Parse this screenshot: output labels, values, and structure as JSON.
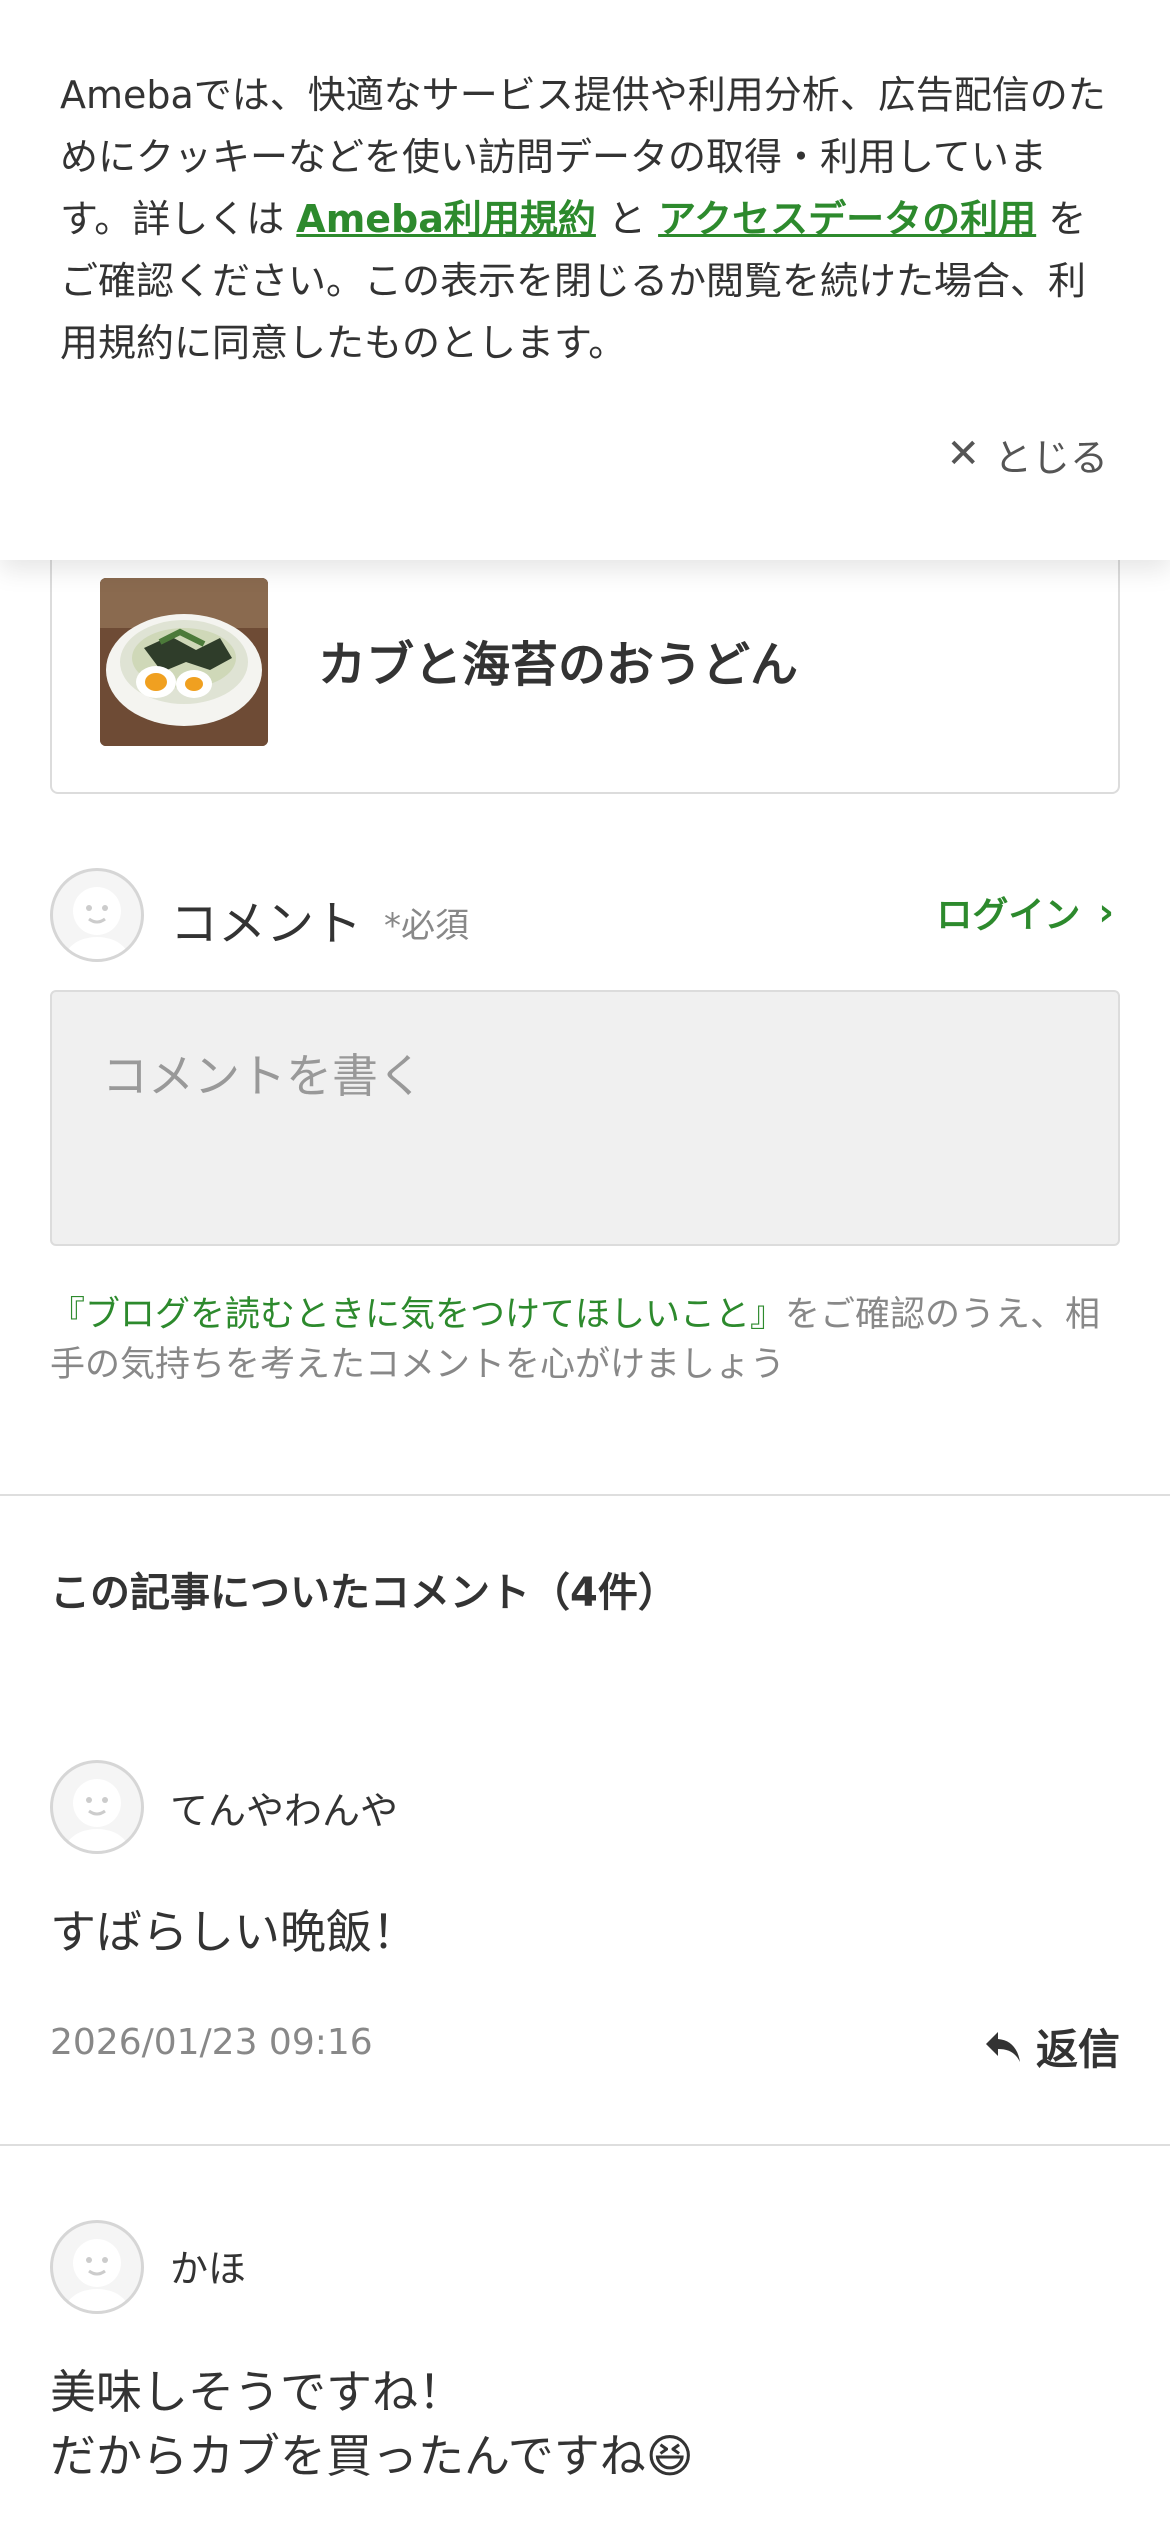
{
  "cookie_banner": {
    "text_1": "Amebaでは、快適なサービス提供や利用分析、広告配信のためにクッキーなどを使い訪問データの取得・利用しています。詳しくは ",
    "link_terms": "Ameba利用規約",
    "text_2": " と ",
    "link_access": "アクセスデータの利用",
    "text_3": " をご確認ください。この表示を閉じるか閲覧を続けた場合、利用規約に同意したものとします。",
    "close_label": "とじる"
  },
  "recipe": {
    "title": "カブと海苔のおうどん"
  },
  "comment_form": {
    "label": "コメント",
    "required": "*必須",
    "login": "ログイン",
    "placeholder": "コメントを書く",
    "guide_link": "『ブログを読むときに気をつけてほしいこと』",
    "guide_text": "をご確認のうえ、相手の気持ちを考えたコメントを心がけましょう"
  },
  "comments_section": {
    "title": "この記事についたコメント（4件）",
    "comments": [
      {
        "author": "てんやわんや",
        "body": "すばらしい晩飯！",
        "date": "2026/01/23 09:16",
        "reply": "返信"
      },
      {
        "author": "かほ",
        "body_line1": "美味しそうですね！",
        "body_line2": "だからカブを買ったんですね😆"
      }
    ]
  },
  "colors": {
    "accent": "#2d8a2d",
    "text": "#333333",
    "muted": "#888888",
    "border": "#dcdcdc"
  }
}
